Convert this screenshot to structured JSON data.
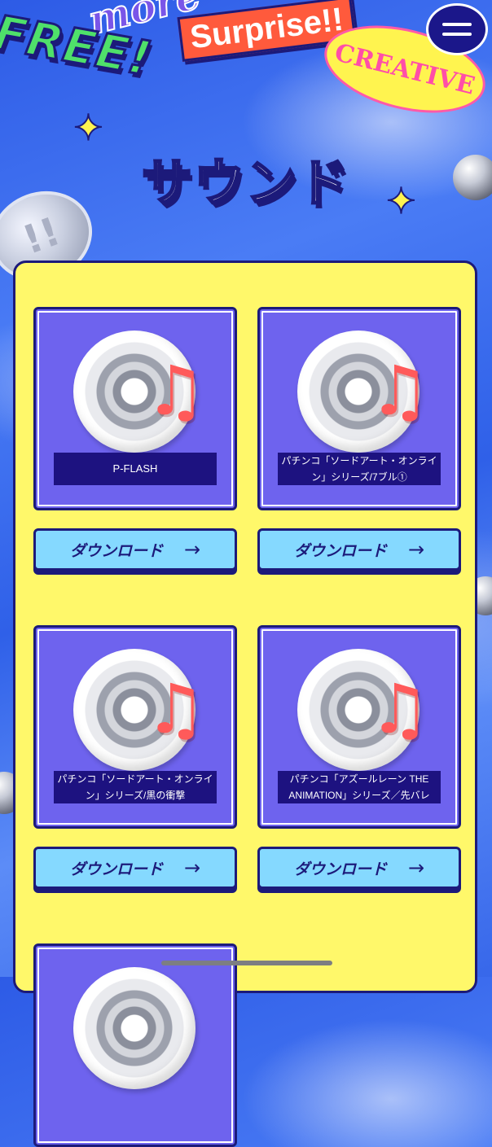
{
  "stickers": {
    "free": "FREE!",
    "more": "more",
    "surprise": "Surprise!!",
    "creative": "CREATIVE"
  },
  "header": {
    "menu_icon": "hamburger-icon"
  },
  "page": {
    "title": "サウンド"
  },
  "cards": [
    {
      "label": "P-FLASH",
      "button": "ダウンロード",
      "icon": "music-disc-icon"
    },
    {
      "label": "パチンコ「ソードアート・オンライン」シリーズ/7ブル①",
      "button": "ダウンロード",
      "icon": "music-disc-icon"
    },
    {
      "label": "パチンコ「ソードアート・オンライン」シリーズ/黒の衝撃",
      "button": "ダウンロード",
      "icon": "music-disc-icon"
    },
    {
      "label": "パチンコ「アズールレーン THE ANIMATION」シリーズ／先バレ",
      "button": "ダウンロード",
      "icon": "music-disc-icon"
    }
  ],
  "colors": {
    "background": "#3a6af0",
    "panel": "#fff86a",
    "card": "#6e63ee",
    "label_bg": "#1d1280",
    "button": "#85d9ff",
    "outline": "#1c1a7a"
  }
}
